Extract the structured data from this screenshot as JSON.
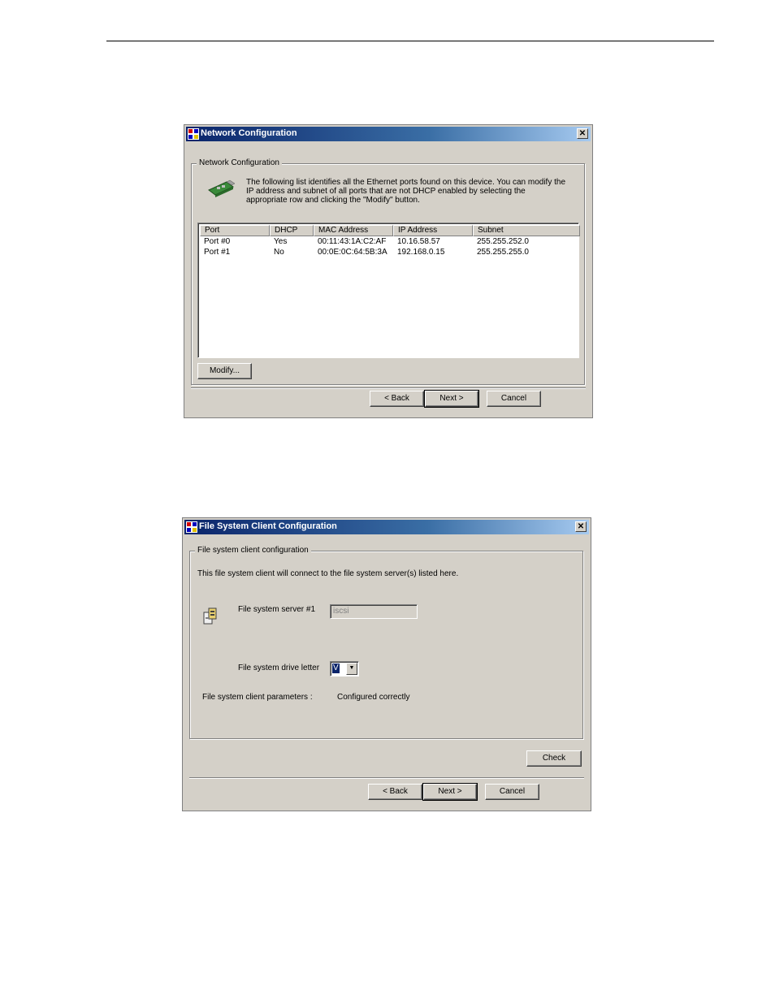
{
  "network_dialog": {
    "title": "Network Configuration",
    "group_label": "Network Configuration",
    "description_line1": "The following list identifies all the Ethernet ports found on this device. You can modify the",
    "description_line2": "IP address and subnet of all ports that are not DHCP enabled by selecting the",
    "description_line3": "appropriate row and clicking the \"Modify\" button.",
    "columns": [
      "Port",
      "DHCP",
      "MAC Address",
      "IP Address",
      "Subnet"
    ],
    "rows": [
      [
        "Port #0",
        "Yes",
        "00:11:43:1A:C2:AF",
        "10.16.58.57",
        "255.255.252.0"
      ],
      [
        "Port #1",
        "No",
        "00:0E:0C:64:5B:3A",
        "192.168.0.15",
        "255.255.255.0"
      ]
    ],
    "modify_label": "Modify...",
    "back_label": "< Back",
    "next_label": "Next >",
    "cancel_label": "Cancel",
    "close_glyph": "✕"
  },
  "fs_dialog": {
    "title": "File System Client Configuration",
    "group_label": "File system client configuration",
    "intro": "This file system client will connect to the file system server(s) listed here.",
    "server_label": "File system server #1",
    "server_value": "iscsi",
    "drive_label": "File system drive letter",
    "drive_value": "V",
    "params_label": "File system client parameters :",
    "params_value": "Configured correctly",
    "check_label": "Check",
    "back_label": "< Back",
    "next_label": "Next >",
    "cancel_label": "Cancel",
    "close_glyph": "✕",
    "combo_arrow": "▼"
  }
}
